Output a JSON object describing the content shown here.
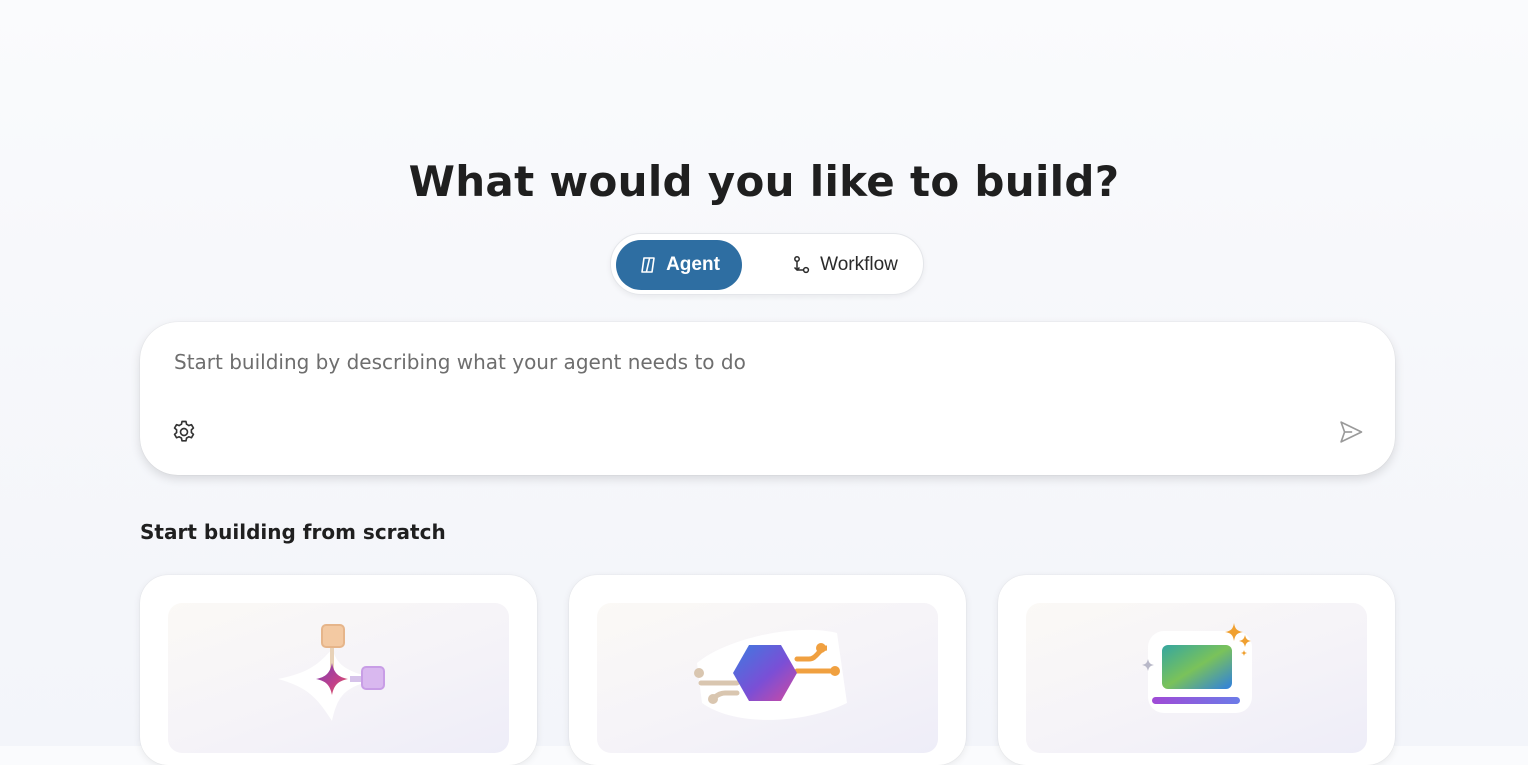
{
  "header": {
    "title": "What would you like to build?"
  },
  "mode_toggle": {
    "options": [
      {
        "label": "Agent",
        "selected": true,
        "icon": "agent-icon"
      },
      {
        "label": "Workflow",
        "selected": false,
        "icon": "workflow-icon"
      }
    ]
  },
  "prompt": {
    "placeholder": "Start building by describing what your agent needs to do",
    "value": "",
    "settings_icon": "gear-icon",
    "send_icon": "send-icon"
  },
  "scratch": {
    "heading": "Start building from scratch",
    "cards": [
      {
        "illustration": "connected-nodes-illustration"
      },
      {
        "illustration": "hexagon-circuit-illustration"
      },
      {
        "illustration": "sparkle-screen-illustration"
      }
    ]
  },
  "colors": {
    "accent": "#2e6ea2",
    "background": "#f7f8fb",
    "text": "#1f1f1f"
  }
}
